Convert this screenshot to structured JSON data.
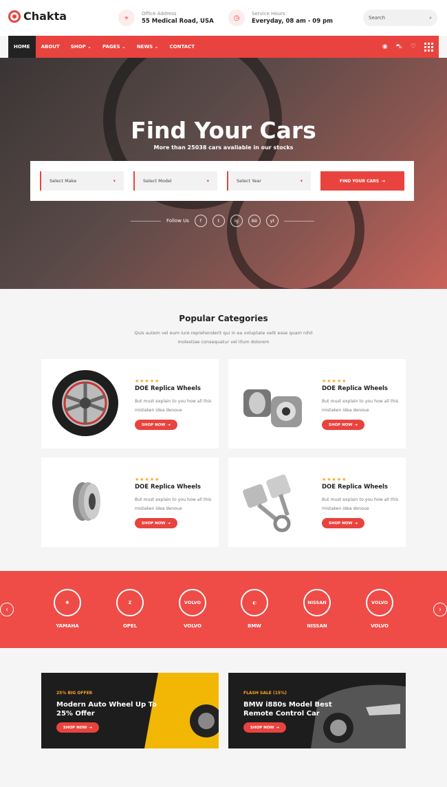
{
  "logo": {
    "name": "Chakta"
  },
  "header": {
    "office": {
      "label": "Office Address",
      "value": "55 Medical Road, USA",
      "icon": "map-pin-icon"
    },
    "hours": {
      "label": "Service Hours",
      "value": "Everyday, 08 am - 09 pm",
      "icon": "clock-icon"
    },
    "search_placeholder": "Search"
  },
  "nav": {
    "items": [
      {
        "label": "HOME",
        "active": true
      },
      {
        "label": "ABOUT"
      },
      {
        "label": "SHOP ⌄"
      },
      {
        "label": "PAGES ⌄"
      },
      {
        "label": "NEWS ⌄"
      },
      {
        "label": "CONTACT"
      }
    ],
    "icons": [
      "user-icon",
      "cart-icon",
      "heart-icon",
      "grid-menu-icon"
    ]
  },
  "hero": {
    "title": "Find Your Cars",
    "subtitle": "More than 25038 cars avaliable in our stocks",
    "selects": [
      "Select Make",
      "Select Model",
      "Select Year"
    ],
    "button": "FIND YOUR CARS",
    "follow_label": "Follow Us",
    "socials": [
      "f",
      "t",
      "ig",
      "Bē",
      "yt"
    ]
  },
  "categories": {
    "title": "Popular Categories",
    "description": "Quis autem vel eum iure reprehenderit qui in ea voluptate velit esse quam nihil molestiae consequatur vel illum dolorem",
    "cards": [
      {
        "title": "DOE Replica Wheels",
        "text": "But must explain to you how all this mistaken idea denoue",
        "button": "SHOP NOW",
        "stars": "★★★★★"
      },
      {
        "title": "DOE Replica Wheels",
        "text": "But must explain to you how all this mistaken idea denoue",
        "button": "SHOP NOW",
        "stars": "★★★★★"
      },
      {
        "title": "DOE Replica Wheels",
        "text": "But must explain to you how all this mistaken idea denoue",
        "button": "SHOP NOW",
        "stars": "★★★★★"
      },
      {
        "title": "DOE Replica Wheels",
        "text": "But must explain to you how all this mistaken idea denoue",
        "button": "SHOP NOW",
        "stars": "★★★★★"
      }
    ]
  },
  "brands": [
    {
      "name": "YAMAHA",
      "mark": "✱"
    },
    {
      "name": "OPEL",
      "mark": "Z"
    },
    {
      "name": "VOLVO",
      "mark": "VOLVO"
    },
    {
      "name": "BMW",
      "mark": "◐"
    },
    {
      "name": "NISSAN",
      "mark": "NISSAN"
    },
    {
      "name": "VOLVO",
      "mark": "VOLVO"
    }
  ],
  "banners": [
    {
      "tag": "25% BIG OFFER",
      "title": "Modern Auto Wheel Up To 25% Offer",
      "button": "SHOP NOW"
    },
    {
      "tag": "FLASH SALE (15%)",
      "title": "BMW i880s Model Best Remote Control Car",
      "button": "SHOP NOW"
    }
  ],
  "colors": {
    "accent": "#e8433e",
    "dark": "#222222",
    "star": "#f6a623"
  }
}
